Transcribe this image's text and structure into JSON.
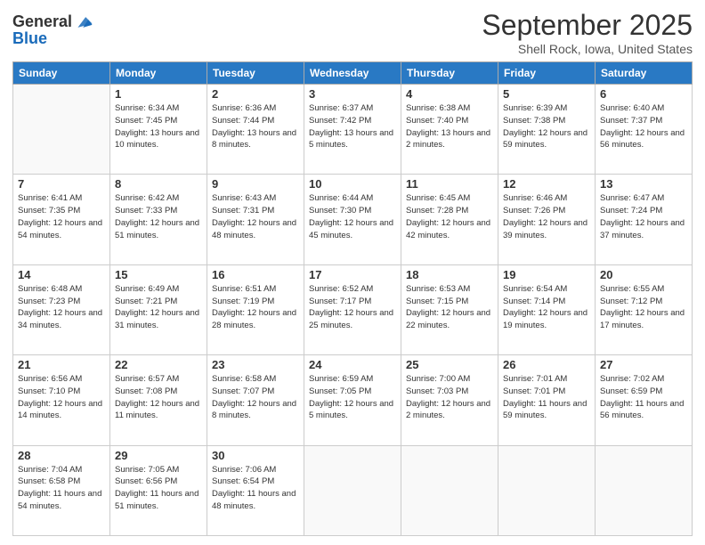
{
  "header": {
    "logo_line1": "General",
    "logo_line2": "Blue",
    "month": "September 2025",
    "location": "Shell Rock, Iowa, United States"
  },
  "weekdays": [
    "Sunday",
    "Monday",
    "Tuesday",
    "Wednesday",
    "Thursday",
    "Friday",
    "Saturday"
  ],
  "weeks": [
    [
      {
        "day": "",
        "sunrise": "",
        "sunset": "",
        "daylight": ""
      },
      {
        "day": "1",
        "sunrise": "Sunrise: 6:34 AM",
        "sunset": "Sunset: 7:45 PM",
        "daylight": "Daylight: 13 hours and 10 minutes."
      },
      {
        "day": "2",
        "sunrise": "Sunrise: 6:36 AM",
        "sunset": "Sunset: 7:44 PM",
        "daylight": "Daylight: 13 hours and 8 minutes."
      },
      {
        "day": "3",
        "sunrise": "Sunrise: 6:37 AM",
        "sunset": "Sunset: 7:42 PM",
        "daylight": "Daylight: 13 hours and 5 minutes."
      },
      {
        "day": "4",
        "sunrise": "Sunrise: 6:38 AM",
        "sunset": "Sunset: 7:40 PM",
        "daylight": "Daylight: 13 hours and 2 minutes."
      },
      {
        "day": "5",
        "sunrise": "Sunrise: 6:39 AM",
        "sunset": "Sunset: 7:38 PM",
        "daylight": "Daylight: 12 hours and 59 minutes."
      },
      {
        "day": "6",
        "sunrise": "Sunrise: 6:40 AM",
        "sunset": "Sunset: 7:37 PM",
        "daylight": "Daylight: 12 hours and 56 minutes."
      }
    ],
    [
      {
        "day": "7",
        "sunrise": "Sunrise: 6:41 AM",
        "sunset": "Sunset: 7:35 PM",
        "daylight": "Daylight: 12 hours and 54 minutes."
      },
      {
        "day": "8",
        "sunrise": "Sunrise: 6:42 AM",
        "sunset": "Sunset: 7:33 PM",
        "daylight": "Daylight: 12 hours and 51 minutes."
      },
      {
        "day": "9",
        "sunrise": "Sunrise: 6:43 AM",
        "sunset": "Sunset: 7:31 PM",
        "daylight": "Daylight: 12 hours and 48 minutes."
      },
      {
        "day": "10",
        "sunrise": "Sunrise: 6:44 AM",
        "sunset": "Sunset: 7:30 PM",
        "daylight": "Daylight: 12 hours and 45 minutes."
      },
      {
        "day": "11",
        "sunrise": "Sunrise: 6:45 AM",
        "sunset": "Sunset: 7:28 PM",
        "daylight": "Daylight: 12 hours and 42 minutes."
      },
      {
        "day": "12",
        "sunrise": "Sunrise: 6:46 AM",
        "sunset": "Sunset: 7:26 PM",
        "daylight": "Daylight: 12 hours and 39 minutes."
      },
      {
        "day": "13",
        "sunrise": "Sunrise: 6:47 AM",
        "sunset": "Sunset: 7:24 PM",
        "daylight": "Daylight: 12 hours and 37 minutes."
      }
    ],
    [
      {
        "day": "14",
        "sunrise": "Sunrise: 6:48 AM",
        "sunset": "Sunset: 7:23 PM",
        "daylight": "Daylight: 12 hours and 34 minutes."
      },
      {
        "day": "15",
        "sunrise": "Sunrise: 6:49 AM",
        "sunset": "Sunset: 7:21 PM",
        "daylight": "Daylight: 12 hours and 31 minutes."
      },
      {
        "day": "16",
        "sunrise": "Sunrise: 6:51 AM",
        "sunset": "Sunset: 7:19 PM",
        "daylight": "Daylight: 12 hours and 28 minutes."
      },
      {
        "day": "17",
        "sunrise": "Sunrise: 6:52 AM",
        "sunset": "Sunset: 7:17 PM",
        "daylight": "Daylight: 12 hours and 25 minutes."
      },
      {
        "day": "18",
        "sunrise": "Sunrise: 6:53 AM",
        "sunset": "Sunset: 7:15 PM",
        "daylight": "Daylight: 12 hours and 22 minutes."
      },
      {
        "day": "19",
        "sunrise": "Sunrise: 6:54 AM",
        "sunset": "Sunset: 7:14 PM",
        "daylight": "Daylight: 12 hours and 19 minutes."
      },
      {
        "day": "20",
        "sunrise": "Sunrise: 6:55 AM",
        "sunset": "Sunset: 7:12 PM",
        "daylight": "Daylight: 12 hours and 17 minutes."
      }
    ],
    [
      {
        "day": "21",
        "sunrise": "Sunrise: 6:56 AM",
        "sunset": "Sunset: 7:10 PM",
        "daylight": "Daylight: 12 hours and 14 minutes."
      },
      {
        "day": "22",
        "sunrise": "Sunrise: 6:57 AM",
        "sunset": "Sunset: 7:08 PM",
        "daylight": "Daylight: 12 hours and 11 minutes."
      },
      {
        "day": "23",
        "sunrise": "Sunrise: 6:58 AM",
        "sunset": "Sunset: 7:07 PM",
        "daylight": "Daylight: 12 hours and 8 minutes."
      },
      {
        "day": "24",
        "sunrise": "Sunrise: 6:59 AM",
        "sunset": "Sunset: 7:05 PM",
        "daylight": "Daylight: 12 hours and 5 minutes."
      },
      {
        "day": "25",
        "sunrise": "Sunrise: 7:00 AM",
        "sunset": "Sunset: 7:03 PM",
        "daylight": "Daylight: 12 hours and 2 minutes."
      },
      {
        "day": "26",
        "sunrise": "Sunrise: 7:01 AM",
        "sunset": "Sunset: 7:01 PM",
        "daylight": "Daylight: 11 hours and 59 minutes."
      },
      {
        "day": "27",
        "sunrise": "Sunrise: 7:02 AM",
        "sunset": "Sunset: 6:59 PM",
        "daylight": "Daylight: 11 hours and 56 minutes."
      }
    ],
    [
      {
        "day": "28",
        "sunrise": "Sunrise: 7:04 AM",
        "sunset": "Sunset: 6:58 PM",
        "daylight": "Daylight: 11 hours and 54 minutes."
      },
      {
        "day": "29",
        "sunrise": "Sunrise: 7:05 AM",
        "sunset": "Sunset: 6:56 PM",
        "daylight": "Daylight: 11 hours and 51 minutes."
      },
      {
        "day": "30",
        "sunrise": "Sunrise: 7:06 AM",
        "sunset": "Sunset: 6:54 PM",
        "daylight": "Daylight: 11 hours and 48 minutes."
      },
      {
        "day": "",
        "sunrise": "",
        "sunset": "",
        "daylight": ""
      },
      {
        "day": "",
        "sunrise": "",
        "sunset": "",
        "daylight": ""
      },
      {
        "day": "",
        "sunrise": "",
        "sunset": "",
        "daylight": ""
      },
      {
        "day": "",
        "sunrise": "",
        "sunset": "",
        "daylight": ""
      }
    ]
  ]
}
